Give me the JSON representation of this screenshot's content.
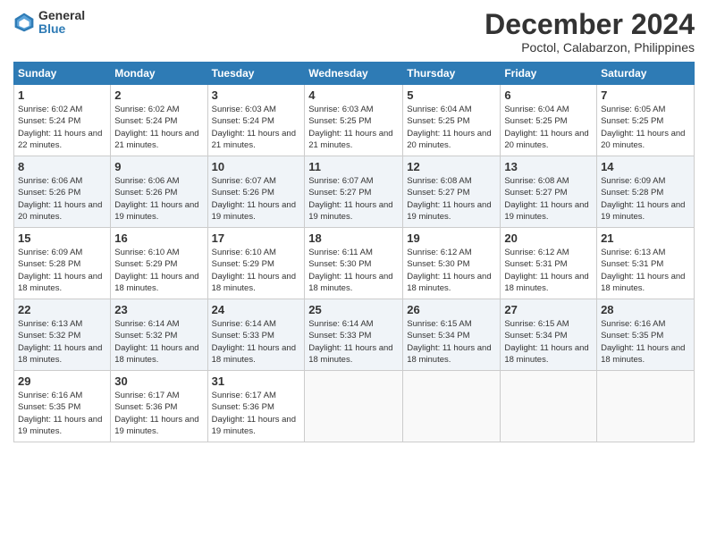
{
  "logo": {
    "general": "General",
    "blue": "Blue"
  },
  "title": "December 2024",
  "subtitle": "Poctol, Calabarzon, Philippines",
  "weekdays": [
    "Sunday",
    "Monday",
    "Tuesday",
    "Wednesday",
    "Thursday",
    "Friday",
    "Saturday"
  ],
  "weeks": [
    [
      {
        "day": 1,
        "sunrise": "6:02 AM",
        "sunset": "5:24 PM",
        "daylight": "11 hours and 22 minutes."
      },
      {
        "day": 2,
        "sunrise": "6:02 AM",
        "sunset": "5:24 PM",
        "daylight": "11 hours and 21 minutes."
      },
      {
        "day": 3,
        "sunrise": "6:03 AM",
        "sunset": "5:24 PM",
        "daylight": "11 hours and 21 minutes."
      },
      {
        "day": 4,
        "sunrise": "6:03 AM",
        "sunset": "5:25 PM",
        "daylight": "11 hours and 21 minutes."
      },
      {
        "day": 5,
        "sunrise": "6:04 AM",
        "sunset": "5:25 PM",
        "daylight": "11 hours and 20 minutes."
      },
      {
        "day": 6,
        "sunrise": "6:04 AM",
        "sunset": "5:25 PM",
        "daylight": "11 hours and 20 minutes."
      },
      {
        "day": 7,
        "sunrise": "6:05 AM",
        "sunset": "5:25 PM",
        "daylight": "11 hours and 20 minutes."
      }
    ],
    [
      {
        "day": 8,
        "sunrise": "6:06 AM",
        "sunset": "5:26 PM",
        "daylight": "11 hours and 20 minutes."
      },
      {
        "day": 9,
        "sunrise": "6:06 AM",
        "sunset": "5:26 PM",
        "daylight": "11 hours and 19 minutes."
      },
      {
        "day": 10,
        "sunrise": "6:07 AM",
        "sunset": "5:26 PM",
        "daylight": "11 hours and 19 minutes."
      },
      {
        "day": 11,
        "sunrise": "6:07 AM",
        "sunset": "5:27 PM",
        "daylight": "11 hours and 19 minutes."
      },
      {
        "day": 12,
        "sunrise": "6:08 AM",
        "sunset": "5:27 PM",
        "daylight": "11 hours and 19 minutes."
      },
      {
        "day": 13,
        "sunrise": "6:08 AM",
        "sunset": "5:27 PM",
        "daylight": "11 hours and 19 minutes."
      },
      {
        "day": 14,
        "sunrise": "6:09 AM",
        "sunset": "5:28 PM",
        "daylight": "11 hours and 19 minutes."
      }
    ],
    [
      {
        "day": 15,
        "sunrise": "6:09 AM",
        "sunset": "5:28 PM",
        "daylight": "11 hours and 18 minutes."
      },
      {
        "day": 16,
        "sunrise": "6:10 AM",
        "sunset": "5:29 PM",
        "daylight": "11 hours and 18 minutes."
      },
      {
        "day": 17,
        "sunrise": "6:10 AM",
        "sunset": "5:29 PM",
        "daylight": "11 hours and 18 minutes."
      },
      {
        "day": 18,
        "sunrise": "6:11 AM",
        "sunset": "5:30 PM",
        "daylight": "11 hours and 18 minutes."
      },
      {
        "day": 19,
        "sunrise": "6:12 AM",
        "sunset": "5:30 PM",
        "daylight": "11 hours and 18 minutes."
      },
      {
        "day": 20,
        "sunrise": "6:12 AM",
        "sunset": "5:31 PM",
        "daylight": "11 hours and 18 minutes."
      },
      {
        "day": 21,
        "sunrise": "6:13 AM",
        "sunset": "5:31 PM",
        "daylight": "11 hours and 18 minutes."
      }
    ],
    [
      {
        "day": 22,
        "sunrise": "6:13 AM",
        "sunset": "5:32 PM",
        "daylight": "11 hours and 18 minutes."
      },
      {
        "day": 23,
        "sunrise": "6:14 AM",
        "sunset": "5:32 PM",
        "daylight": "11 hours and 18 minutes."
      },
      {
        "day": 24,
        "sunrise": "6:14 AM",
        "sunset": "5:33 PM",
        "daylight": "11 hours and 18 minutes."
      },
      {
        "day": 25,
        "sunrise": "6:14 AM",
        "sunset": "5:33 PM",
        "daylight": "11 hours and 18 minutes."
      },
      {
        "day": 26,
        "sunrise": "6:15 AM",
        "sunset": "5:34 PM",
        "daylight": "11 hours and 18 minutes."
      },
      {
        "day": 27,
        "sunrise": "6:15 AM",
        "sunset": "5:34 PM",
        "daylight": "11 hours and 18 minutes."
      },
      {
        "day": 28,
        "sunrise": "6:16 AM",
        "sunset": "5:35 PM",
        "daylight": "11 hours and 18 minutes."
      }
    ],
    [
      {
        "day": 29,
        "sunrise": "6:16 AM",
        "sunset": "5:35 PM",
        "daylight": "11 hours and 19 minutes."
      },
      {
        "day": 30,
        "sunrise": "6:17 AM",
        "sunset": "5:36 PM",
        "daylight": "11 hours and 19 minutes."
      },
      {
        "day": 31,
        "sunrise": "6:17 AM",
        "sunset": "5:36 PM",
        "daylight": "11 hours and 19 minutes."
      },
      null,
      null,
      null,
      null
    ]
  ]
}
